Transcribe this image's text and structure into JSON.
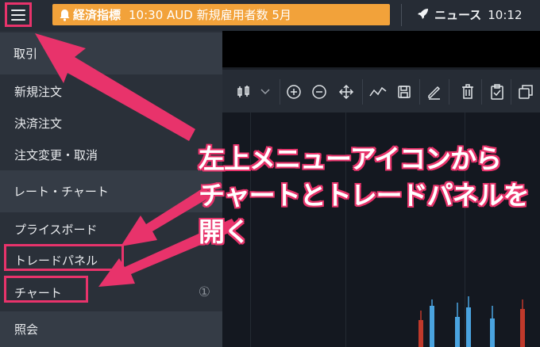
{
  "topbar": {
    "alert_label": "経済指標",
    "alert_message": "10:30 AUD 新規雇用者数 5月",
    "news_label": "ニュース",
    "news_time": "10:12"
  },
  "menu": {
    "section_trade": "取引",
    "new_order": "新規注文",
    "settle_order": "決済注文",
    "modify_order": "注文変更・取消",
    "section_rate_chart": "レート・チャート",
    "price_board": "プライスボード",
    "trade_panel": "トレードパネル",
    "chart": "チャート",
    "chart_badge": "①",
    "inquiry": "照会"
  },
  "annotation": {
    "line1": "左上メニューアイコンから",
    "line2": "チャートとトレードパネルを開く"
  },
  "colors": {
    "accent_pink": "#e8336b",
    "alert_orange": "#f2a23a",
    "candle_blue": "#4aa3df",
    "candle_red": "#c0392b"
  },
  "icons": [
    "menu-icon",
    "bell-icon",
    "rocket-icon",
    "candlestick-icon",
    "chevron-down-icon",
    "zoom-in-icon",
    "zoom-out-icon",
    "move-icon",
    "draw-line-icon",
    "save-icon",
    "pencil-icon",
    "trash-icon",
    "clipboard-check-icon",
    "windows-icon"
  ]
}
